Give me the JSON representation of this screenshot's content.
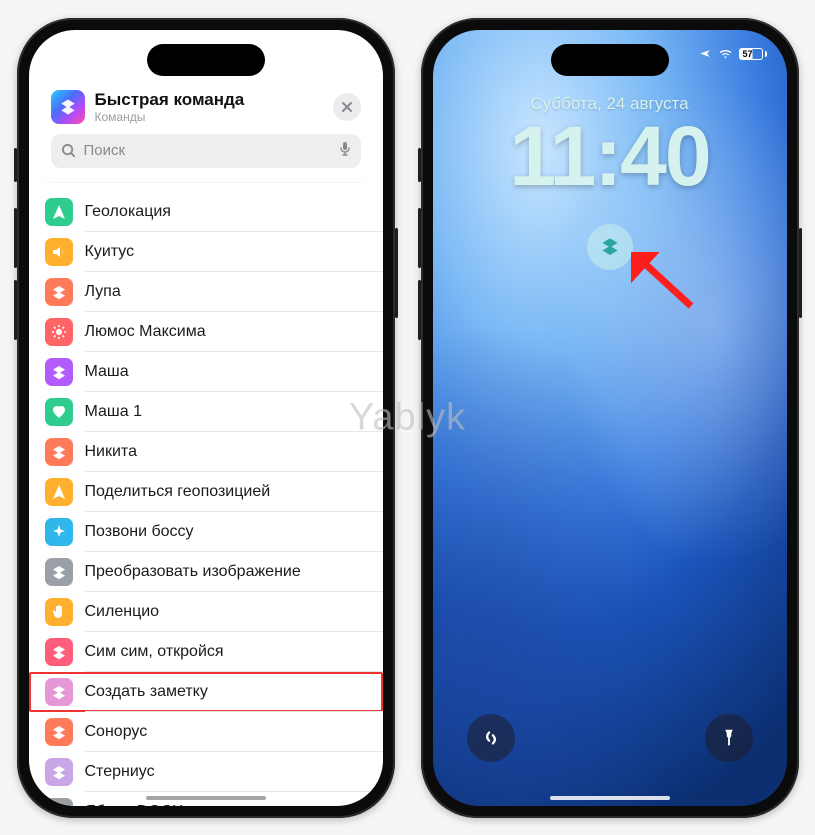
{
  "watermark": "Yablyk",
  "left": {
    "header": {
      "title": "Быстрая команда",
      "subtitle": "Команды"
    },
    "search": {
      "placeholder": "Поиск"
    },
    "items": [
      {
        "label": "Геолокация",
        "icon": "location",
        "color": "#2ecc8f"
      },
      {
        "label": "Куитус",
        "icon": "speaker",
        "color": "#ffb02e"
      },
      {
        "label": "Лупа",
        "icon": "shortcut",
        "color": "#ff7a59"
      },
      {
        "label": "Люмос Максима",
        "icon": "sun",
        "color": "#ff6466"
      },
      {
        "label": "Маша",
        "icon": "shortcut",
        "color": "#b25bff"
      },
      {
        "label": "Маша 1",
        "icon": "heart",
        "color": "#2ecc8f"
      },
      {
        "label": "Никита",
        "icon": "shortcut",
        "color": "#ff7a59"
      },
      {
        "label": "Поделиться геопозицией",
        "icon": "location",
        "color": "#ffb02e"
      },
      {
        "label": "Позвони боссу",
        "icon": "sparkle",
        "color": "#2fb7ec"
      },
      {
        "label": "Преобразовать изображение",
        "icon": "shortcut",
        "color": "#9aa0a6"
      },
      {
        "label": "Силенцио",
        "icon": "hand",
        "color": "#ffb02e"
      },
      {
        "label": "Сим сим, откройся",
        "icon": "shortcut",
        "color": "#ff5d7a"
      },
      {
        "label": "Создать заметку",
        "icon": "shortcut",
        "color": "#e597d6",
        "highlight": true
      },
      {
        "label": "Сонорус",
        "icon": "shortcut",
        "color": "#ff7a59"
      },
      {
        "label": "Стерниус",
        "icon": "shortcut",
        "color": "#c8a6e8"
      },
      {
        "label": "Яблык DOCX",
        "icon": "shortcut",
        "color": "#9aa0a6"
      }
    ]
  },
  "right": {
    "date": "Суббота, 24 августа",
    "time": "11:40",
    "battery": "57"
  }
}
